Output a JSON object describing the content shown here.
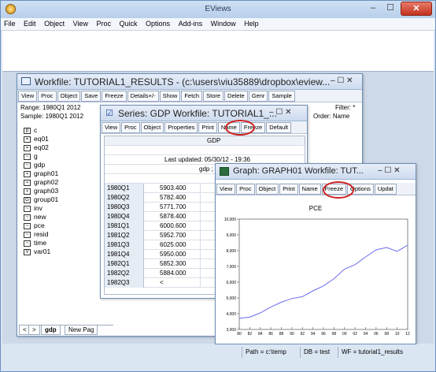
{
  "app": {
    "title": "EViews",
    "min": "–",
    "max": "☐",
    "close": "✕"
  },
  "menu": [
    "File",
    "Edit",
    "Object",
    "View",
    "Proc",
    "Quick",
    "Options",
    "Add-ins",
    "Window",
    "Help"
  ],
  "workfile": {
    "title": "Workfile: TUTORIAL1_RESULTS - (c:\\users\\viu35889\\dropbox\\eview...",
    "controls": "–  ☐  ✕",
    "toolbar": [
      "View",
      "Proc",
      "Object",
      "Save",
      "Freeze",
      "Details+/-",
      "Show",
      "Fetch",
      "Store",
      "Delete",
      "Genr",
      "Sample"
    ],
    "range": "Range:  1980Q1 2012",
    "sample": "Sample: 1980Q1 2012",
    "filter": "Filter: *",
    "order": "Order: Name",
    "objects": [
      {
        "icon": "coef-icon",
        "glyph": "β",
        "name": "c"
      },
      {
        "icon": "equation-icon",
        "glyph": "=",
        "name": "eq01"
      },
      {
        "icon": "equation-icon",
        "glyph": "=",
        "name": "eq02"
      },
      {
        "icon": "series-icon",
        "glyph": "~",
        "name": "g"
      },
      {
        "icon": "series-icon",
        "glyph": "~",
        "name": "gdp"
      },
      {
        "icon": "graph-icon",
        "glyph": "▪",
        "name": "graph01"
      },
      {
        "icon": "graph-icon",
        "glyph": "▪",
        "name": "graph02"
      },
      {
        "icon": "graph-icon",
        "glyph": "▪",
        "name": "graph03"
      },
      {
        "icon": "group-icon",
        "glyph": "G",
        "name": "group01"
      },
      {
        "icon": "series-icon",
        "glyph": "~",
        "name": "inv"
      },
      {
        "icon": "series-icon",
        "glyph": "~",
        "name": "new"
      },
      {
        "icon": "series-icon",
        "glyph": "~",
        "name": "pce"
      },
      {
        "icon": "series-icon",
        "glyph": "~",
        "name": "resid"
      },
      {
        "icon": "series-icon",
        "glyph": "~",
        "name": "time"
      },
      {
        "icon": "var-icon",
        "glyph": "V",
        "name": "var01"
      }
    ],
    "tabs": [
      "<",
      ">",
      "gdp",
      "New Pag"
    ]
  },
  "series": {
    "title": "Series: GDP   Workfile: TUTORIAL1_...",
    "controls": "–  ☐  ✕",
    "toolbar": [
      "View",
      "Proc",
      "Object",
      "Properties",
      "Print",
      "Name",
      "Freeze",
      "Default"
    ],
    "colheader": "GDP",
    "lastupdated": "Last updated: 05/30/12 - 19:36",
    "gdpline": "gdp ; S",
    "rows": [
      {
        "period": "1980Q1",
        "value": "5903.400"
      },
      {
        "period": "1980Q2",
        "value": "5782.400"
      },
      {
        "period": "1980Q3",
        "value": "5771.700"
      },
      {
        "period": "1980Q4",
        "value": "5878.400"
      },
      {
        "period": "1981Q1",
        "value": "6000.600"
      },
      {
        "period": "1981Q2",
        "value": "5952.700"
      },
      {
        "period": "1981Q3",
        "value": "6025.000"
      },
      {
        "period": "1981Q4",
        "value": "5950.000"
      },
      {
        "period": "1982Q1",
        "value": "5852.300"
      },
      {
        "period": "1982Q2",
        "value": "5884.000"
      },
      {
        "period": "1982Q3",
        "value": "<"
      }
    ]
  },
  "graph": {
    "title": "Graph: GRAPH01   Workfile: TUT...",
    "controls": "–  ☐  ✕",
    "toolbar": [
      "View",
      "Proc",
      "Object",
      "Print",
      "Name",
      "Freeze",
      "Options",
      "Updat"
    ],
    "plot_title": "PCE",
    "yticks": [
      "10,000",
      "9,000",
      "8,000",
      "7,000",
      "6,000",
      "5,000",
      "4,000",
      "3,000"
    ],
    "xticks": [
      "80",
      "82",
      "84",
      "86",
      "88",
      "90",
      "92",
      "94",
      "96",
      "98",
      "00",
      "02",
      "04",
      "06",
      "08",
      "10",
      "12"
    ],
    "line_color": "#6a6af0"
  },
  "status": {
    "path": "Path = c:\\temp",
    "db": "DB = test",
    "wf": "WF = tutorial1_results"
  },
  "chart_data": {
    "type": "line",
    "title": "PCE",
    "x": [
      "1980",
      "1982",
      "1984",
      "1986",
      "1988",
      "1990",
      "1992",
      "1994",
      "1996",
      "1998",
      "2000",
      "2002",
      "2004",
      "2006",
      "2008",
      "2010",
      "2012"
    ],
    "series": [
      {
        "name": "PCE",
        "values": [
          3700,
          3780,
          4050,
          4420,
          4730,
          4960,
          5080,
          5450,
          5760,
          6220,
          6830,
          7110,
          7600,
          8050,
          8200,
          7950,
          8350
        ]
      }
    ],
    "ylim": [
      3000,
      10000
    ]
  }
}
